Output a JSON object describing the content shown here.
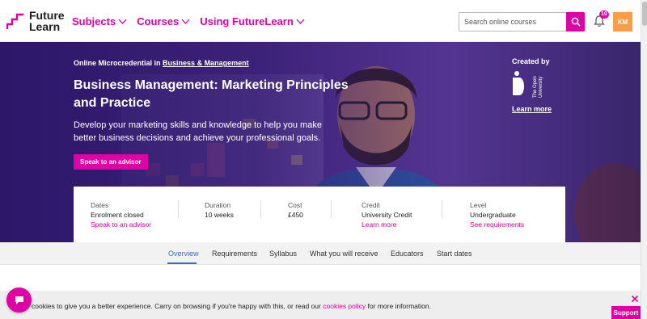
{
  "brand": {
    "name_line1": "Future",
    "name_line2": "Learn",
    "accent": "#de00a5"
  },
  "nav": {
    "items": [
      {
        "label": "Subjects"
      },
      {
        "label": "Courses"
      },
      {
        "label": "Using FutureLearn"
      }
    ]
  },
  "search": {
    "placeholder": "Search online courses",
    "icon": "search-icon"
  },
  "notifications": {
    "count": "10",
    "icon": "bell-icon"
  },
  "user": {
    "initials": "KM"
  },
  "hero": {
    "eyebrow_prefix": "Online Microcredential in",
    "eyebrow_link": "Business & Management",
    "title": "Business Management: Marketing Principles and Practice",
    "description": "Develop your marketing skills and knowledge to help you make better business decisions and achieve your professional goals.",
    "cta": "Speak to an advisor",
    "created_by": "Created by",
    "partner_line1": "The Open",
    "partner_line2": "University",
    "learn_more": "Learn more"
  },
  "details": {
    "dates": {
      "label": "Dates",
      "value": "Enrolment closed",
      "link": "Speak to an advisor"
    },
    "duration": {
      "label": "Duration",
      "value": "10 weeks"
    },
    "cost": {
      "label": "Cost",
      "value": "£450"
    },
    "credit": {
      "label": "Credit",
      "value": "University Credit",
      "link": "Learn more"
    },
    "level": {
      "label": "Level",
      "value": "Undergraduate",
      "link": "See requirements"
    }
  },
  "tabs": [
    {
      "label": "Overview",
      "active": true
    },
    {
      "label": "Requirements"
    },
    {
      "label": "Syllabus"
    },
    {
      "label": "What you will receive"
    },
    {
      "label": "Educators"
    },
    {
      "label": "Start dates"
    }
  ],
  "cookie": {
    "text_before": "cookies to give you a better experience. Carry on browsing if you're happy with this, or read our",
    "link": "cookies policy",
    "text_after": "for more information."
  },
  "support": {
    "label": "Support"
  }
}
